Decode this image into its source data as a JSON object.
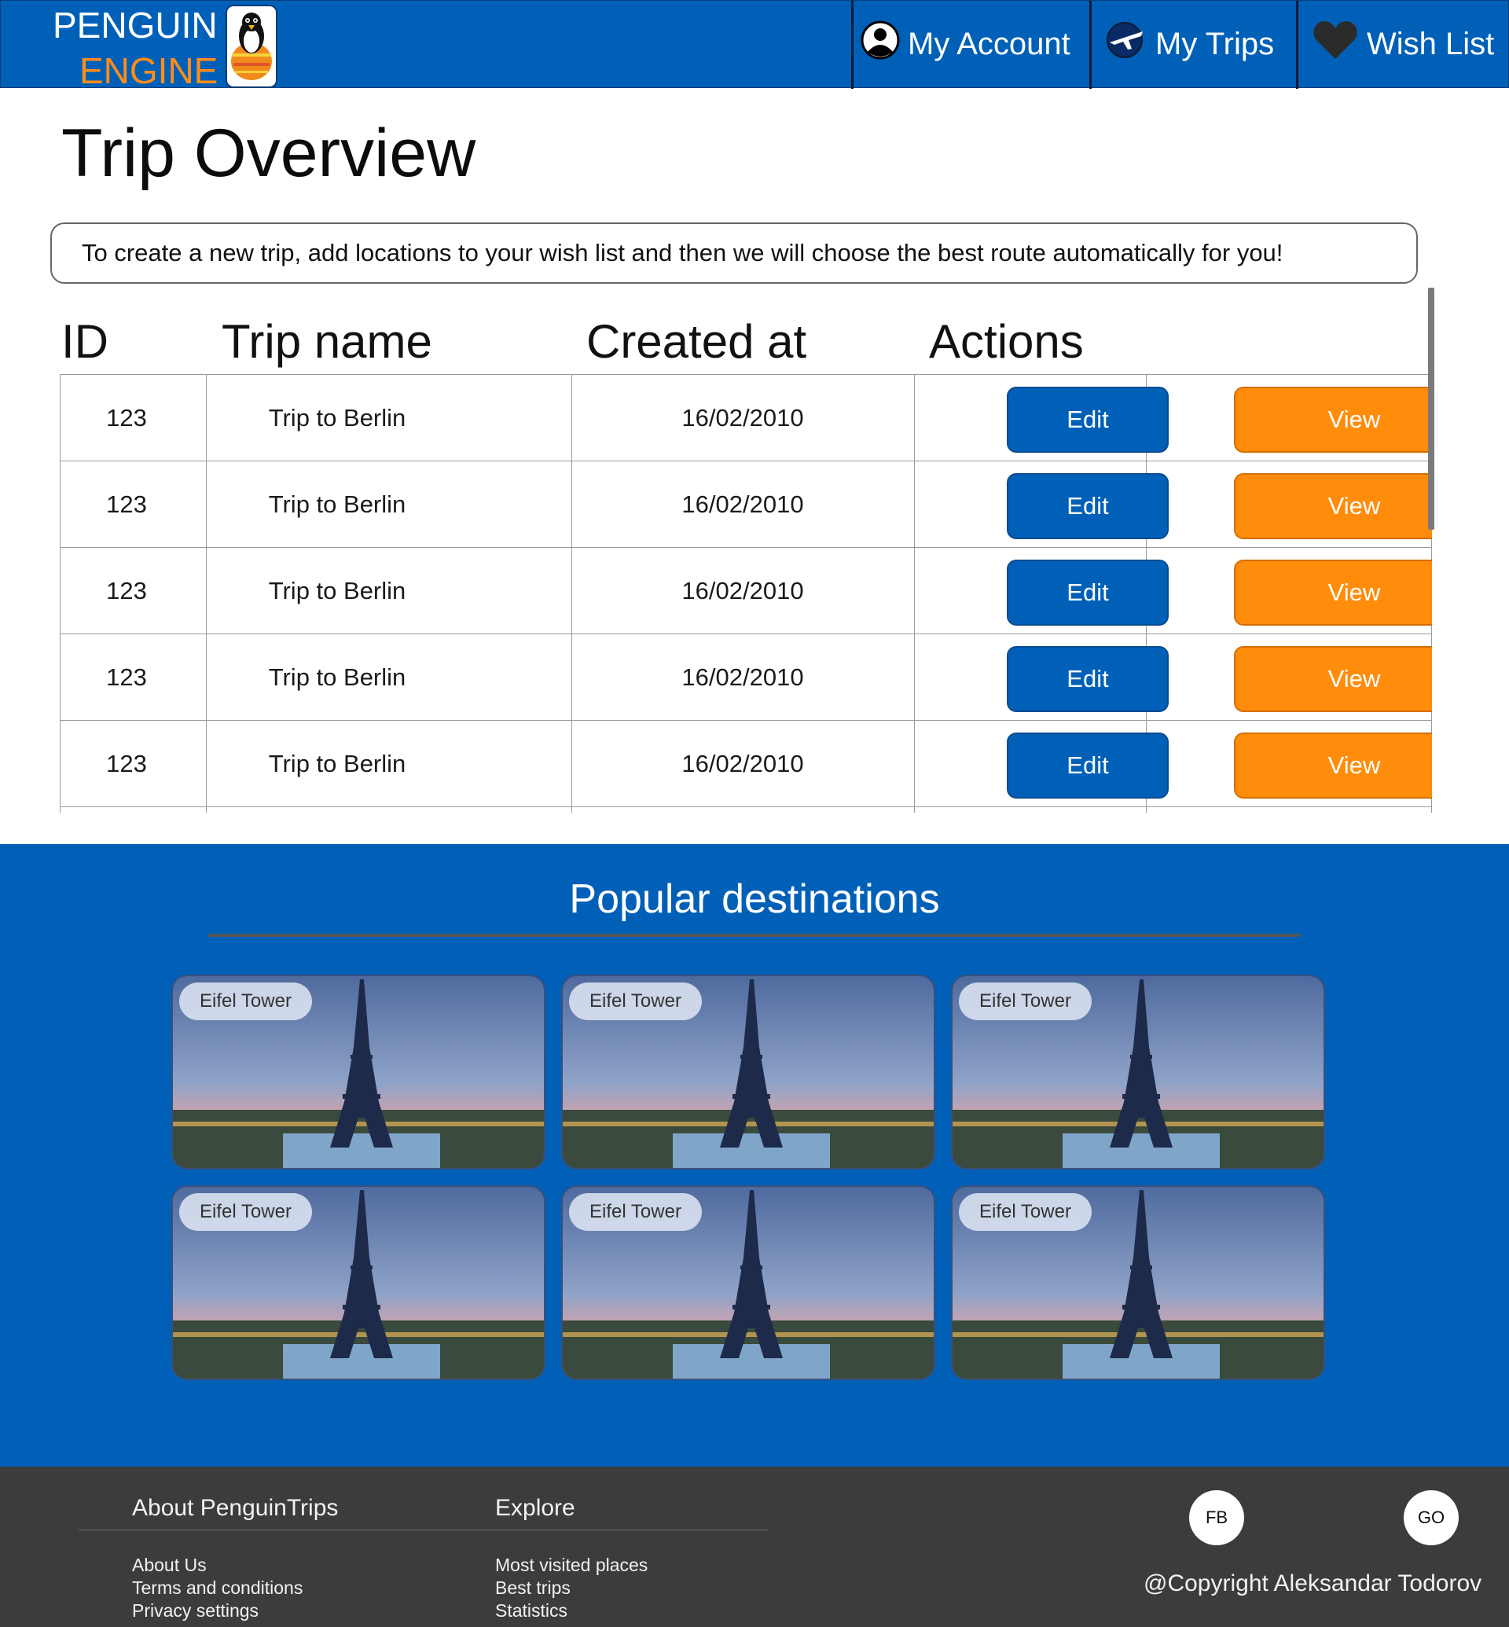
{
  "header": {
    "logo_line1": "PENGUIN",
    "logo_line2": "ENGINE",
    "nav": [
      {
        "label": "My Account",
        "icon": "user-circle-icon"
      },
      {
        "label": "My Trips",
        "icon": "airplane-globe-icon"
      },
      {
        "label": "Wish List",
        "icon": "heart-icon"
      }
    ]
  },
  "main": {
    "title": "Trip Overview",
    "info": "To create a new trip, add locations to your wish list and then we will choose the best route automatically for you!",
    "table": {
      "columns": [
        "ID",
        "Trip name",
        "Created at",
        "Actions"
      ],
      "rows": [
        {
          "id": "123",
          "name": "Trip to Berlin",
          "created": "16/02/2010",
          "edit": "Edit",
          "view": "View"
        },
        {
          "id": "123",
          "name": "Trip to Berlin",
          "created": "16/02/2010",
          "edit": "Edit",
          "view": "View"
        },
        {
          "id": "123",
          "name": "Trip to Berlin",
          "created": "16/02/2010",
          "edit": "Edit",
          "view": "View"
        },
        {
          "id": "123",
          "name": "Trip to Berlin",
          "created": "16/02/2010",
          "edit": "Edit",
          "view": "View"
        },
        {
          "id": "123",
          "name": "Trip to Berlin",
          "created": "16/02/2010",
          "edit": "Edit",
          "view": "View"
        }
      ]
    }
  },
  "popular": {
    "title": "Popular destinations",
    "cards": [
      {
        "label": "Eifel Tower"
      },
      {
        "label": "Eifel Tower"
      },
      {
        "label": "Eifel Tower"
      },
      {
        "label": "Eifel Tower"
      },
      {
        "label": "Eifel Tower"
      },
      {
        "label": "Eifel Tower"
      }
    ]
  },
  "footer": {
    "about": {
      "heading": "About PenguinTrips",
      "links": [
        "About Us",
        "Terms and conditions",
        "Privacy settings"
      ]
    },
    "explore": {
      "heading": "Explore",
      "links": [
        "Most visited places",
        "Best trips",
        "Statistics"
      ]
    },
    "social": [
      "FB",
      "GO"
    ],
    "copyright": "@Copyright Aleksandar Todorov"
  },
  "colors": {
    "brand_blue": "#0060b8",
    "accent_orange": "#ff8c0a",
    "footer_bg": "#3c3c3c"
  }
}
